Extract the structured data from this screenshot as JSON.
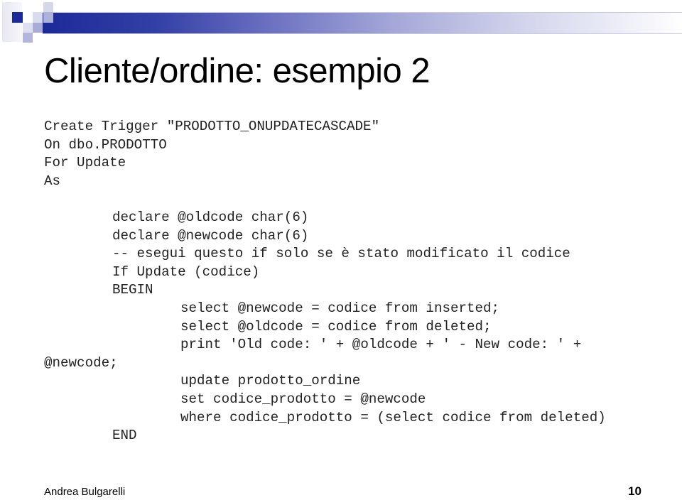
{
  "slide": {
    "title": "Cliente/ordine: esempio 2",
    "accent_color": "#1c2a99",
    "code_lines": [
      {
        "indent": 0,
        "text": "Create Trigger \"PRODOTTO_ONUPDATECASCADE\""
      },
      {
        "indent": 0,
        "text": "On dbo.PRODOTTO"
      },
      {
        "indent": 0,
        "text": "For Update"
      },
      {
        "indent": 0,
        "text": "As"
      },
      {
        "indent": 0,
        "text": ""
      },
      {
        "indent": 1,
        "text": "declare @oldcode char(6)"
      },
      {
        "indent": 1,
        "text": "declare @newcode char(6)"
      },
      {
        "indent": 1,
        "text": "-- esegui questo if solo se è stato modificato il codice"
      },
      {
        "indent": 1,
        "text": "If Update (codice)"
      },
      {
        "indent": 1,
        "text": "BEGIN"
      },
      {
        "indent": 2,
        "text": "select @newcode = codice from inserted;"
      },
      {
        "indent": 2,
        "text": "select @oldcode = codice from deleted;"
      },
      {
        "indent": 2,
        "text": "print 'Old code: ' + @oldcode + ' - New code: ' +"
      },
      {
        "indent": 0,
        "text": "@newcode;"
      },
      {
        "indent": 2,
        "text": "update prodotto_ordine"
      },
      {
        "indent": 2,
        "text": "set codice_prodotto = @newcode"
      },
      {
        "indent": 2,
        "text": "where codice_prodotto = (select codice from deleted)"
      },
      {
        "indent": 1,
        "text": "END"
      }
    ],
    "footer": {
      "author": "Andrea Bulgarelli",
      "page_number": "10"
    }
  }
}
